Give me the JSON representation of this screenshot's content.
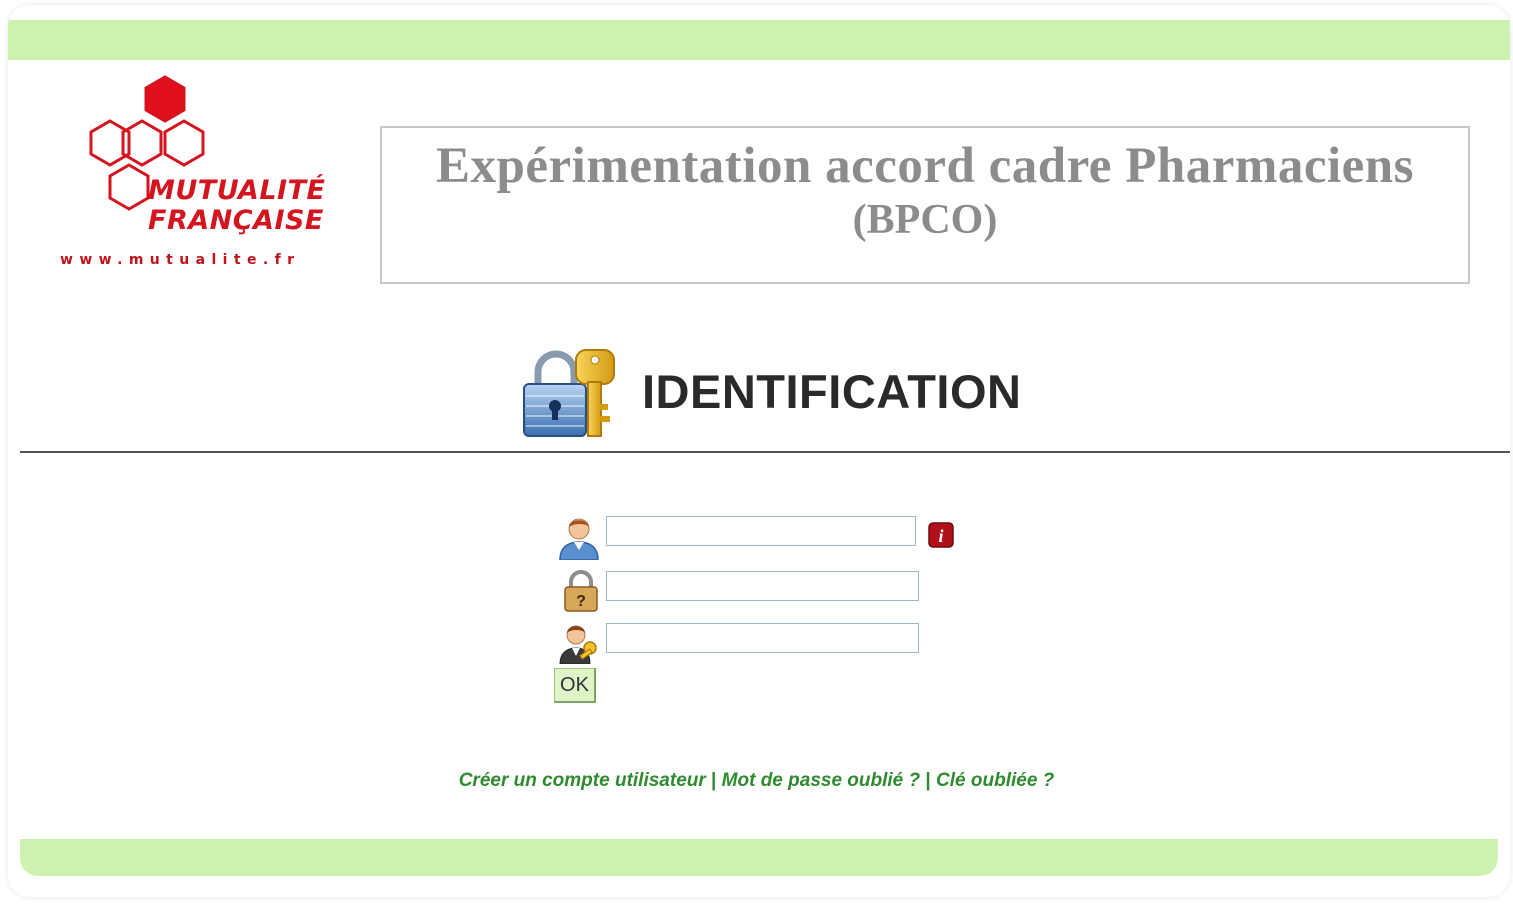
{
  "logo": {
    "line1": "MUTUALITÉ",
    "line2": "FRANÇAISE",
    "url": "www.mutualite.fr",
    "color": "#d4141e"
  },
  "header": {
    "title_line1": "Expérimentation accord cadre Pharmaciens",
    "title_line2": "(BPCO)"
  },
  "identification": {
    "title": "IDENTIFICATION",
    "icon": "lock-key-icon"
  },
  "form": {
    "login": {
      "icon": "user-icon",
      "value": "",
      "placeholder": ""
    },
    "password": {
      "icon": "padlock-question-icon",
      "value": "",
      "placeholder": ""
    },
    "key": {
      "icon": "user-key-icon",
      "value": "",
      "placeholder": ""
    },
    "info_icon": "info-icon",
    "submit_label": "OK"
  },
  "links": {
    "create_account": "Créer un compte utilisateur",
    "separator": "|",
    "forgot_password": "Mot de passe oublié ?",
    "forgot_key": "Clé oubliée ?"
  },
  "colors": {
    "bar": "#cdf1b0",
    "link": "#2e8b2e",
    "title": "#8c8c8c"
  }
}
